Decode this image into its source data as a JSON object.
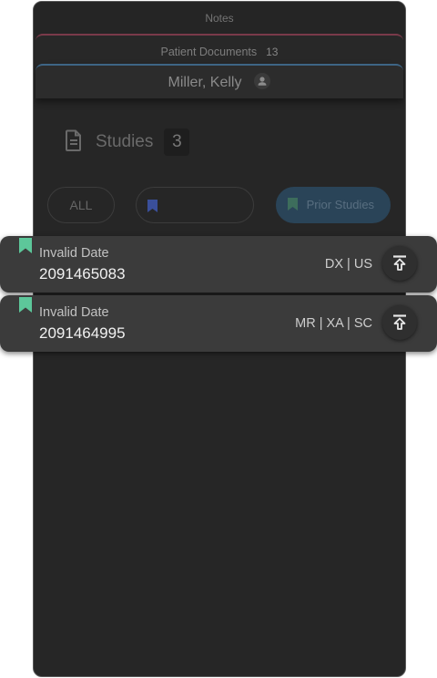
{
  "tabs": {
    "notes": "Notes",
    "patient_documents": "Patient Documents",
    "patient_documents_count": "13",
    "patient_name": "Miller, Kelly"
  },
  "studies": {
    "title": "Studies",
    "count": "3"
  },
  "filters": {
    "all": "ALL",
    "prior": "Prior Studies"
  },
  "cards": [
    {
      "date": "Invalid Date",
      "id": "2091465083",
      "modalities": "DX | US"
    },
    {
      "date": "Invalid Date",
      "id": "2091464995",
      "modalities": "MR | XA | SC"
    }
  ],
  "icons": {
    "person": "person-icon",
    "document": "document-icon",
    "bookmark": "bookmark-icon",
    "upload": "upload-icon"
  },
  "colors": {
    "panel_bg": "#262626",
    "card_bg": "#3b3b3b",
    "bookmark_green": "#5dc79a",
    "bookmark_blue": "#3a4f9a",
    "prior_bg": "#2a4458",
    "docs_tab_accent": "#7a3a4a",
    "patient_tab_accent": "#3e6585"
  }
}
